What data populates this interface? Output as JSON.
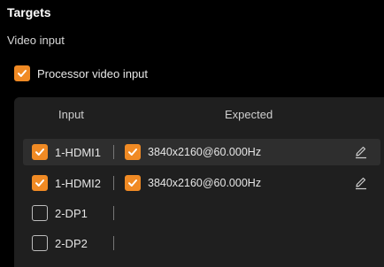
{
  "header": {
    "title": "Targets",
    "section": "Video input"
  },
  "processor": {
    "label": "Processor video input",
    "checked": true
  },
  "table": {
    "col_input": "Input",
    "col_expected": "Expected",
    "rows": [
      {
        "input_checked": true,
        "input": "1-HDMI1",
        "expected_checked": true,
        "expected": "3840x2160@60.000Hz",
        "selected": true
      },
      {
        "input_checked": true,
        "input": "1-HDMI2",
        "expected_checked": true,
        "expected": "3840x2160@60.000Hz",
        "selected": false
      },
      {
        "input_checked": false,
        "input": "2-DP1",
        "expected_checked": false,
        "expected": "",
        "selected": false
      },
      {
        "input_checked": false,
        "input": "2-DP2",
        "expected_checked": false,
        "expected": "",
        "selected": false
      }
    ]
  },
  "colors": {
    "accent": "#f08a24",
    "background": "#000000",
    "panel": "#1f1f1f"
  }
}
